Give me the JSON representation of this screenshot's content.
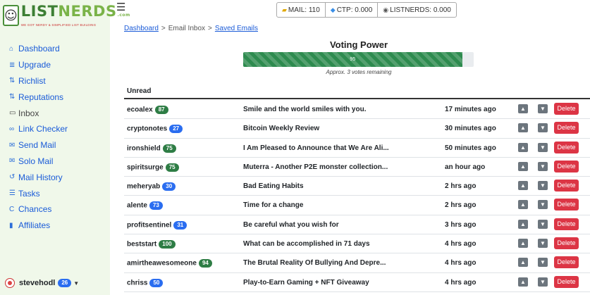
{
  "logo": {
    "mark": "☺",
    "name_a": "LIST",
    "name_b": "NERDS",
    "suffix": ".com",
    "tagline": "WE GOT NERDY & SIMPLIFIED LIST BUILDING"
  },
  "sidebar": {
    "items": [
      {
        "label": "Dashboard",
        "icon": "home-icon",
        "glyph": "⌂"
      },
      {
        "label": "Upgrade",
        "icon": "layers-icon",
        "glyph": "≣"
      },
      {
        "label": "Richlist",
        "icon": "sort-icon",
        "glyph": "⇅"
      },
      {
        "label": "Reputations",
        "icon": "sort-icon",
        "glyph": "⇅"
      },
      {
        "label": "Inbox",
        "icon": "inbox-icon",
        "glyph": "▭"
      },
      {
        "label": "Link Checker",
        "icon": "link-icon",
        "glyph": "∞"
      },
      {
        "label": "Send Mail",
        "icon": "envelope-icon",
        "glyph": "✉"
      },
      {
        "label": "Solo Mail",
        "icon": "envelope-icon",
        "glyph": "✉"
      },
      {
        "label": "Mail History",
        "icon": "history-icon",
        "glyph": "↺"
      },
      {
        "label": "Tasks",
        "icon": "tasks-icon",
        "glyph": "☰"
      },
      {
        "label": "Chances",
        "icon": "chances-icon",
        "glyph": "C"
      },
      {
        "label": "Affiliates",
        "icon": "signal-icon",
        "glyph": "▮"
      }
    ]
  },
  "user": {
    "name": "stevehodl",
    "badge": "26"
  },
  "counters": {
    "mail": "MAIL: 110",
    "ctp": "CTP: 0.000",
    "listnerds": "LISTNERDS: 0.000"
  },
  "breadcrumb": {
    "dashboard": "Dashboard",
    "current": "Email Inbox",
    "saved": "Saved Emails",
    "sep": ">"
  },
  "voting": {
    "title": "Voting Power",
    "value_label": "95",
    "value": 95,
    "max": 100,
    "note": "Approx. 3 votes remaining"
  },
  "table": {
    "header": "Unread",
    "delete_label": "Delete",
    "up_glyph": "▲",
    "down_glyph": "▼",
    "rows": [
      {
        "sender": "ecoalex",
        "badge": "87",
        "badge_color": "green",
        "subject": "Smile and the world smiles with you.",
        "time": "17 minutes ago"
      },
      {
        "sender": "cryptonotes",
        "badge": "27",
        "badge_color": "blue",
        "subject": "Bitcoin Weekly Review",
        "time": "30 minutes ago"
      },
      {
        "sender": "ironshield",
        "badge": "75",
        "badge_color": "green",
        "subject": "I Am Pleased to Announce that We Are Ali...",
        "time": "50 minutes ago"
      },
      {
        "sender": "spiritsurge",
        "badge": "75",
        "badge_color": "green",
        "subject": "Muterra - Another P2E monster collection...",
        "time": "an hour ago"
      },
      {
        "sender": "meheryab",
        "badge": "30",
        "badge_color": "blue",
        "subject": "Bad Eating Habits",
        "time": "2 hrs ago"
      },
      {
        "sender": "alente",
        "badge": "73",
        "badge_color": "blue",
        "subject": "Time for a change",
        "time": "2 hrs ago"
      },
      {
        "sender": "profitsentinel",
        "badge": "31",
        "badge_color": "blue",
        "subject": "Be careful what you wish for",
        "time": "3 hrs ago"
      },
      {
        "sender": "beststart",
        "badge": "100",
        "badge_color": "green",
        "subject": "What can be accomplished in 71 days",
        "time": "4 hrs ago"
      },
      {
        "sender": "amirtheawesomeone",
        "badge": "94",
        "badge_color": "green",
        "subject": "The Brutal Reality Of Bullying And Depre...",
        "time": "4 hrs ago"
      },
      {
        "sender": "chriss",
        "badge": "50",
        "badge_color": "blue",
        "subject": "Play-to-Earn Gaming + NFT Giveaway",
        "time": "4 hrs ago"
      }
    ]
  },
  "colors": {
    "sidebar_bg": "#f0f8ea",
    "link": "#1a5bd8",
    "progress": "#2e8b4f",
    "delete": "#dc3545",
    "badge_green": "#2e7d45",
    "badge_blue": "#2a6df0"
  }
}
